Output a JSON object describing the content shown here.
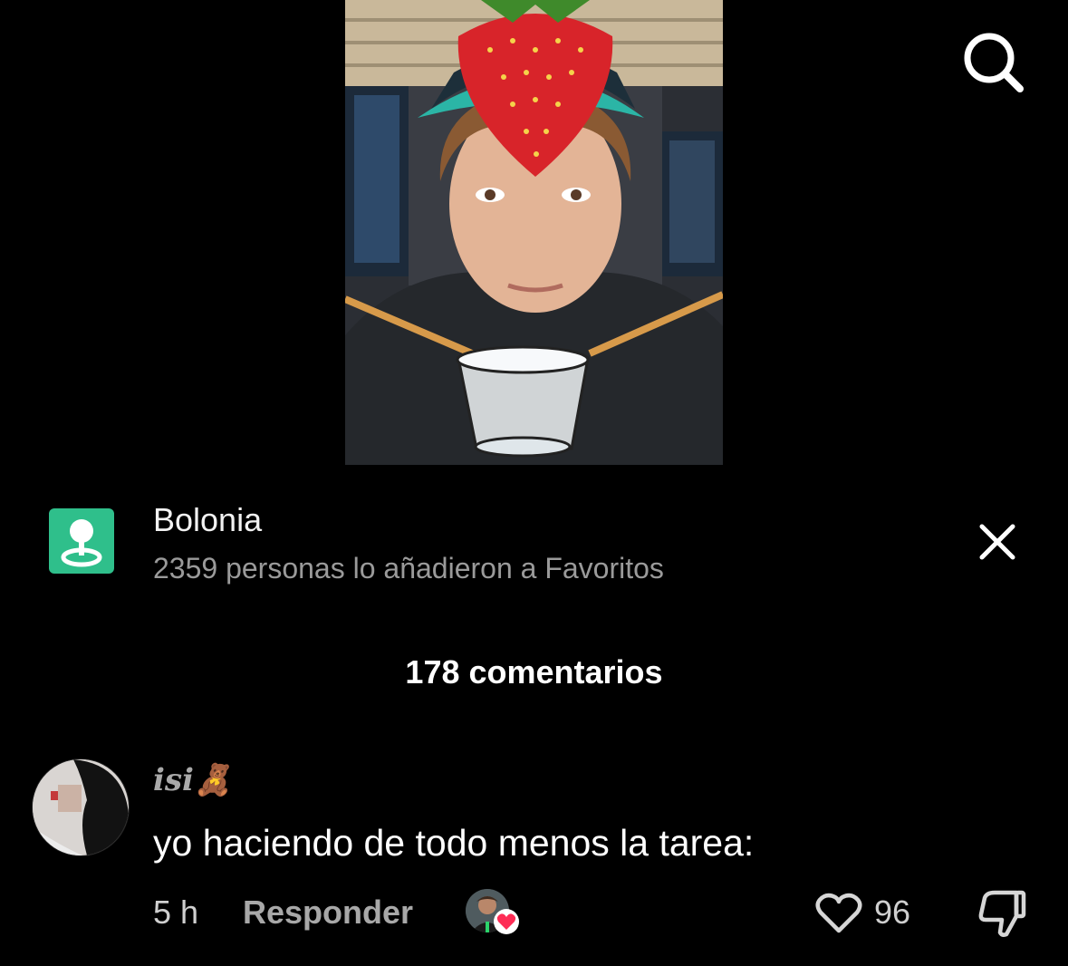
{
  "location": {
    "name": "Bolonia",
    "favorites_text": "2359 personas lo añadieron a Favoritos",
    "icon": "map-pin-icon",
    "icon_bg": "#2fbf8b"
  },
  "header": {
    "search_icon": "search-icon"
  },
  "comments": {
    "count_label": "178 comentarios"
  },
  "comment": {
    "username": "isi🧸",
    "text": "yo haciendo de todo menos la tarea:",
    "time": "5 h",
    "reply_label": "Responder",
    "likes": "96",
    "creator_liked": true,
    "like_badge_color": "#fe2c55"
  }
}
